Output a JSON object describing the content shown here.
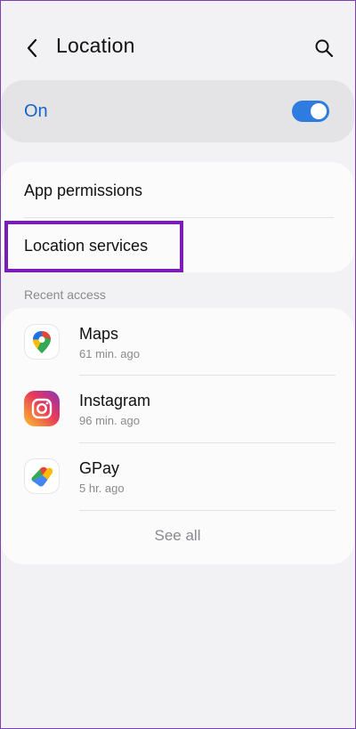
{
  "header": {
    "title": "Location",
    "back_icon": "chevron-left-icon",
    "search_icon": "search-icon"
  },
  "master_switch": {
    "label": "On",
    "state": true,
    "accent_color": "#2f7ce0",
    "label_color": "#1566c4"
  },
  "settings": {
    "items": [
      {
        "label": "App permissions"
      },
      {
        "label": "Location services"
      }
    ]
  },
  "highlight_color": "#7a1cb8",
  "recent": {
    "section_label": "Recent access",
    "apps": [
      {
        "name": "Maps",
        "time": "61 min. ago",
        "icon": "google-maps-icon"
      },
      {
        "name": "Instagram",
        "time": "96 min. ago",
        "icon": "instagram-icon"
      },
      {
        "name": "GPay",
        "time": "5 hr. ago",
        "icon": "google-pay-icon"
      }
    ],
    "see_all_label": "See all"
  }
}
